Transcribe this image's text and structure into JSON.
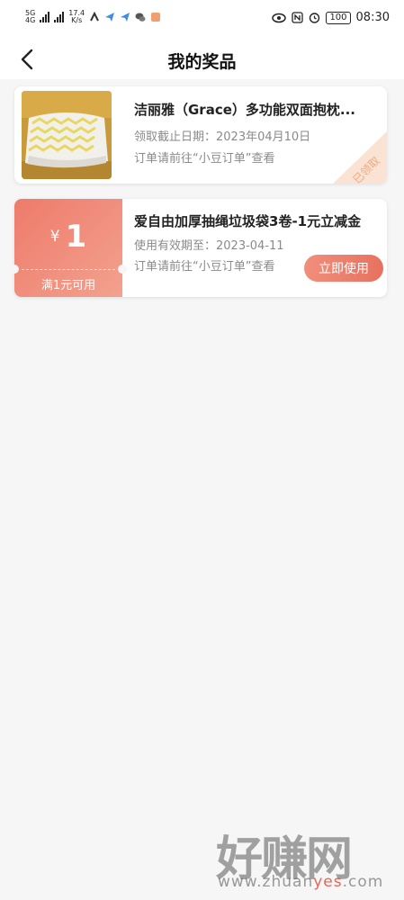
{
  "status_bar": {
    "net_left_top": "5G",
    "net_left_bottom": "4G",
    "speed_value": "17.4",
    "speed_unit": "K/s",
    "battery": "100",
    "time": "08:30"
  },
  "header": {
    "title": "我的奖品"
  },
  "prizes": [
    {
      "name": "洁丽雅（Grace）多功能双面抱枕...",
      "deadline": "领取截止日期：2023年04月10日",
      "hint": "订单请前往“小豆订单”查看",
      "stamp": "已领取"
    }
  ],
  "coupons": [
    {
      "currency": "¥",
      "amount": "1",
      "condition": "满1元可用",
      "title": "爱自由加厚抽绳垃圾袋3卷-1元立减金",
      "validity": "使用有效期至：2023-04-11",
      "hint": "订单请前往“小豆订单”查看",
      "button_label": "立即使用"
    }
  ],
  "watermark": {
    "text": "好赚网",
    "url_prefix": "www.zhuan",
    "url_highlight": "yes",
    "url_suffix": ".com"
  },
  "colors": {
    "coupon_gradient_start": "#ee7b6a",
    "coupon_gradient_end": "#f3a18f",
    "stamp": "#f5c3a6"
  }
}
